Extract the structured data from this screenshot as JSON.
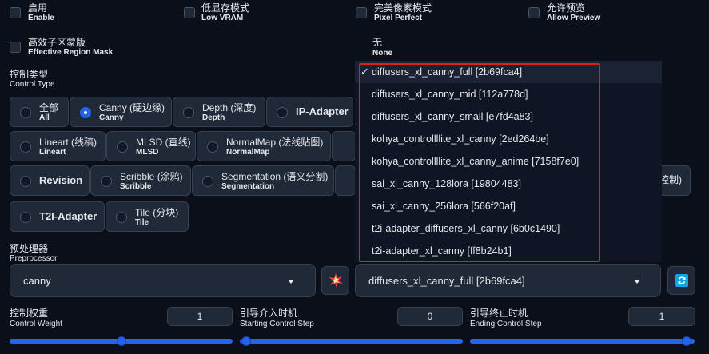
{
  "options": {
    "enable": {
      "zh": "启用",
      "en": "Enable"
    },
    "low_vram": {
      "zh": "低显存模式",
      "en": "Low VRAM"
    },
    "pixel_perfect": {
      "zh": "完美像素模式",
      "en": "Pixel Perfect"
    },
    "allow_preview": {
      "zh": "允许预览",
      "en": "Allow Preview"
    },
    "effective_region_mask": {
      "zh": "高效子区蒙版",
      "en": "Effective Region Mask"
    }
  },
  "model_header": {
    "zh": "无",
    "en": "None"
  },
  "control_type": {
    "zh": "控制类型",
    "en": "Control Type",
    "radios": [
      {
        "zh": "全部",
        "en": "All"
      },
      {
        "zh": "Canny (硬边缘)",
        "en": "Canny",
        "selected": true
      },
      {
        "zh": "Depth (深度)",
        "en": "Depth"
      },
      {
        "label": "IP-Adapter"
      },
      {
        "zh": "Lineart (线稿)",
        "en": "Lineart"
      },
      {
        "zh": "MLSD (直线)",
        "en": "MLSD"
      },
      {
        "zh": "NormalMap (法线贴图)",
        "en": "NormalMap"
      },
      {
        "label": "Revision"
      },
      {
        "zh": "Scribble (涂鸦)",
        "en": "Scribble"
      },
      {
        "zh": "Segmentation (语义分割)",
        "en": "Segmentation"
      },
      {
        "label": "T2I-Adapter"
      },
      {
        "zh": "Tile (分块)",
        "en": "Tile"
      }
    ],
    "partial_hidden": "控制)"
  },
  "model_dropdown": {
    "items": [
      "diffusers_xl_canny_full [2b69fca4]",
      "diffusers_xl_canny_mid [112a778d]",
      "diffusers_xl_canny_small [e7fd4a83]",
      "kohya_controllllite_xl_canny [2ed264be]",
      "kohya_controllllite_xl_canny_anime [7158f7e0]",
      "sai_xl_canny_128lora [19804483]",
      "sai_xl_canny_256lora [566f20af]",
      "t2i-adapter_diffusers_xl_canny [6b0c1490]",
      "t2i-adapter_xl_canny [ff8b24b1]"
    ],
    "selected_index": 0,
    "selected_value": "diffusers_xl_canny_full [2b69fca4]",
    "check": "✓"
  },
  "preprocessor": {
    "zh": "预处理器",
    "en": "Preprocessor",
    "value": "canny"
  },
  "control_weight": {
    "zh": "控制权重",
    "en": "Control Weight",
    "value": "1",
    "fraction": 0.5
  },
  "starting_step": {
    "zh": "引导介入时机",
    "en": "Starting Control Step",
    "value": "0",
    "fraction": 0.0
  },
  "ending_step": {
    "zh": "引导终止时机",
    "en": "Ending Control Step",
    "value": "1",
    "fraction": 1.0
  },
  "colors": {
    "accent": "#2563eb",
    "highlight": "#e11d1d",
    "background": "#0b0f19"
  },
  "icons": {
    "run_preprocessor": "explosion-icon",
    "refresh": "refresh-icon"
  }
}
